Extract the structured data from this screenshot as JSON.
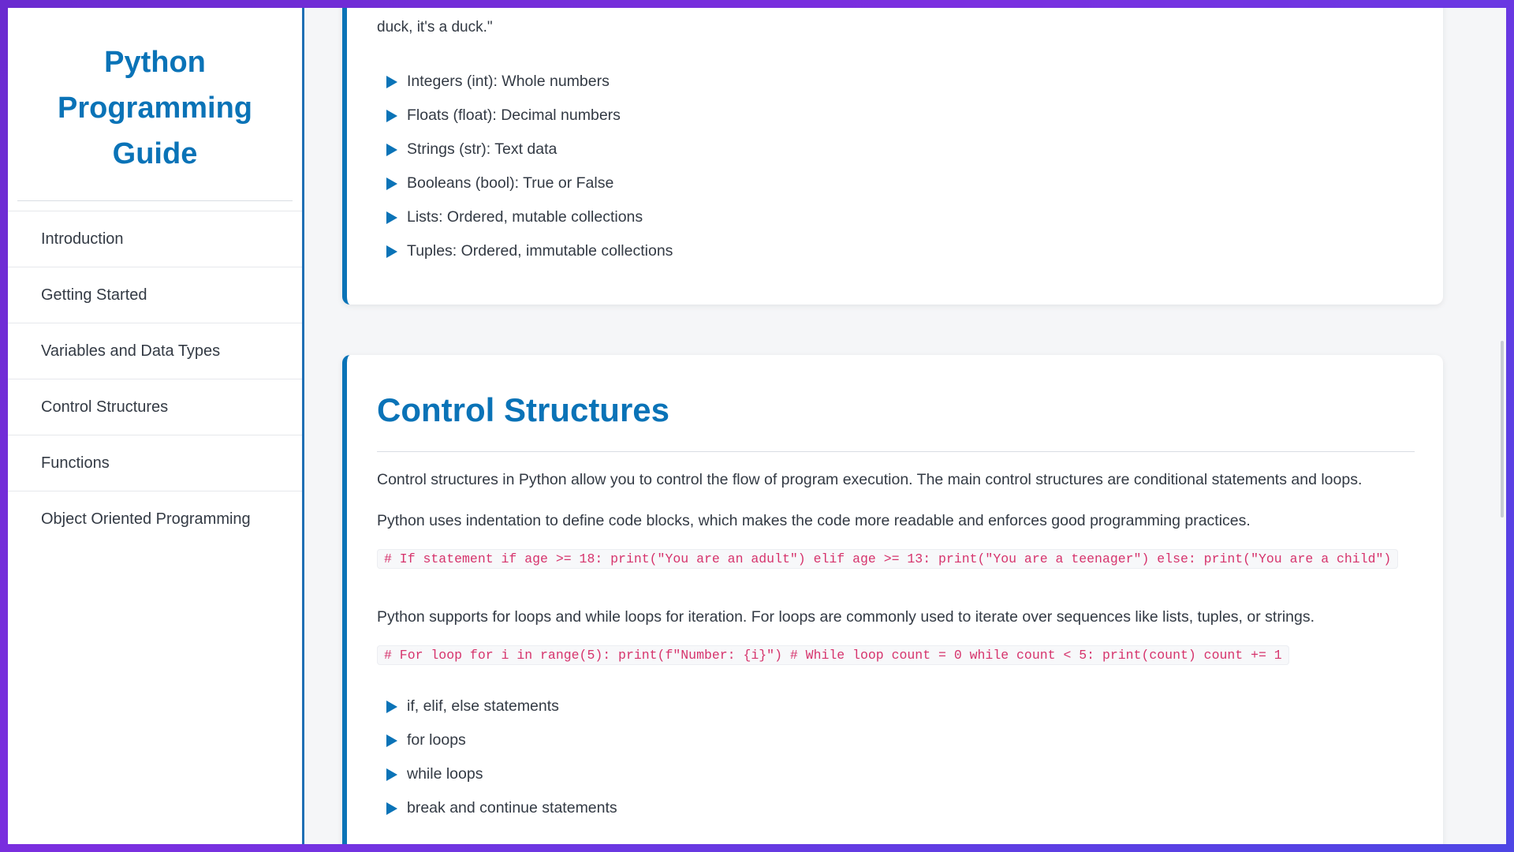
{
  "sidebar": {
    "title": "Python Programming Guide",
    "items": [
      {
        "label": "Introduction"
      },
      {
        "label": "Getting Started"
      },
      {
        "label": "Variables and Data Types"
      },
      {
        "label": "Control Structures"
      },
      {
        "label": "Functions"
      },
      {
        "label": "Object Oriented Programming"
      }
    ]
  },
  "data_types_section": {
    "text_tail": "duck, it's a duck.\"",
    "bullets": [
      "Integers (int): Whole numbers",
      "Floats (float): Decimal numbers",
      "Strings (str): Text data",
      "Booleans (bool): True or False",
      "Lists: Ordered, mutable collections",
      "Tuples: Ordered, immutable collections"
    ]
  },
  "control_section": {
    "heading": "Control Structures",
    "para1": "Control structures in Python allow you to control the flow of program execution. The main control structures are conditional statements and loops.",
    "para2": "Python uses indentation to define code blocks, which makes the code more readable and enforces good programming practices.",
    "code1": "# If statement if age >= 18: print(\"You are an adult\") elif age >= 13: print(\"You are a teenager\") else: print(\"You are a child\")",
    "para3": "Python supports for loops and while loops for iteration. For loops are commonly used to iterate over sequences like lists, tuples, or strings.",
    "code2": "# For loop for i in range(5): print(f\"Number: {i}\") # While loop count = 0 while count < 5: print(count) count += 1",
    "bullets": [
      "if, elif, else statements",
      "for loops",
      "while loops",
      "break and continue statements"
    ]
  },
  "colors": {
    "accent": "#0a73b7",
    "code_text": "#d6336c",
    "body_text": "#333a44"
  }
}
